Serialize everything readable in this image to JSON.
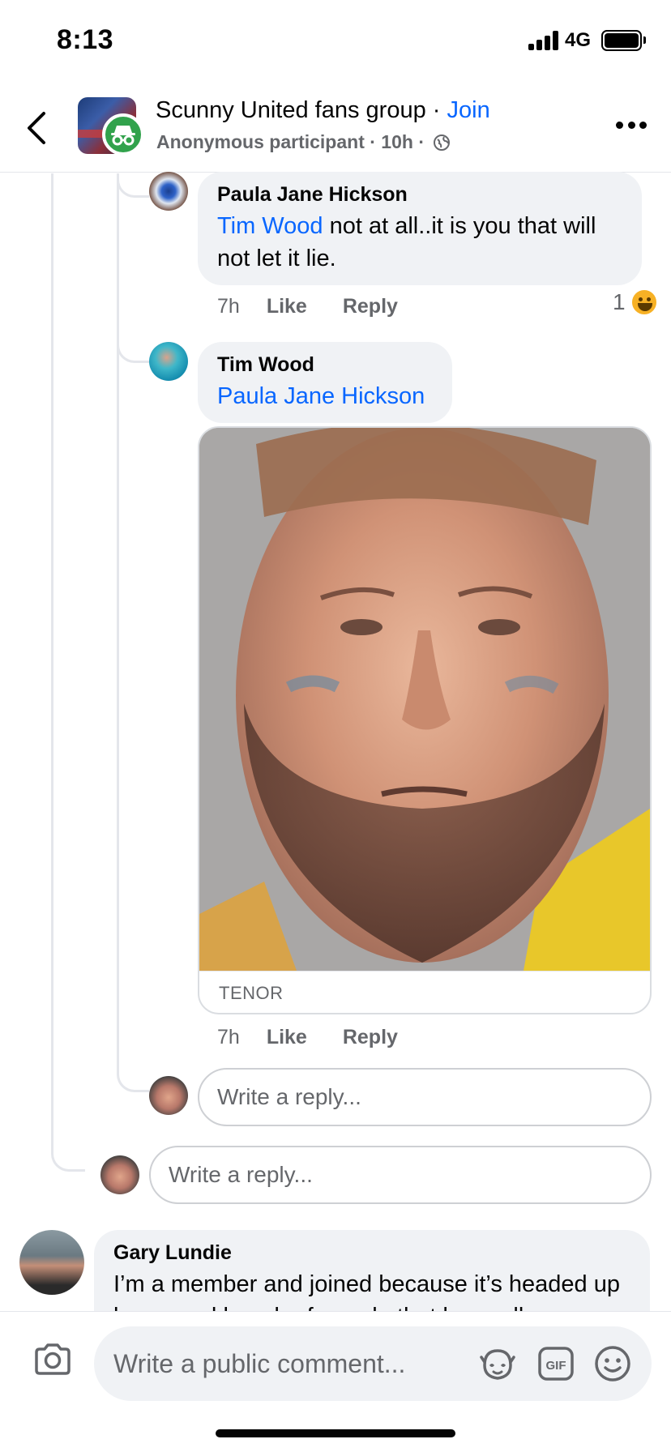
{
  "status_bar": {
    "time": "8:13",
    "network": "4G"
  },
  "header": {
    "group_name": "Scunny United fans group",
    "separator": " · ",
    "join_label": "Join",
    "subtitle": "Anonymous participant · 10h ·"
  },
  "comments": [
    {
      "author": "Paula Jane Hickson",
      "mention": "Tim Wood",
      "text": " not at all..it is you that will not let it lie.",
      "time": "7h",
      "like_label": "Like",
      "reply_label": "Reply",
      "reaction_count": "1"
    },
    {
      "author": "Tim Wood",
      "mention": "Paula Jane Hickson",
      "gif_source": "TENOR",
      "time": "7h",
      "like_label": "Like",
      "reply_label": "Reply"
    },
    {
      "author": "Gary Lundie",
      "text": "I’m a member and joined because it’s headed up by a good bunch of people that have all"
    }
  ],
  "reply_placeholder": "Write a reply...",
  "comment_bar": {
    "placeholder": "Write a public comment..."
  },
  "icons": {
    "back": "chevron-left-icon",
    "more": "more-icon",
    "camera": "camera-icon",
    "avatar_sticker": "sticker-icon",
    "gif": "gif-icon",
    "emoji": "emoji-icon"
  },
  "colors": {
    "link": "#0866ff",
    "bubble": "#f0f2f5",
    "secondary_text": "#65676b",
    "anonymous_badge": "#31a24c"
  }
}
